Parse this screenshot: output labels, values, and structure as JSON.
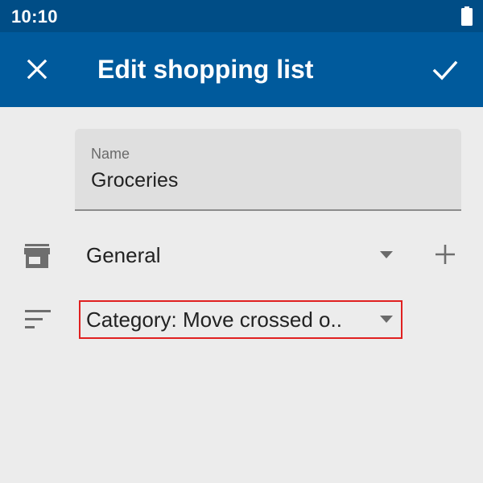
{
  "status_bar": {
    "time": "10:10",
    "battery_icon": "battery-full-icon"
  },
  "app_bar": {
    "title": "Edit shopping list",
    "close_icon": "close-icon",
    "confirm_icon": "check-icon"
  },
  "form": {
    "name_field": {
      "label": "Name",
      "value": "Groceries"
    },
    "store": {
      "icon": "store-icon",
      "selected": "General",
      "add_icon": "plus-icon"
    },
    "sort": {
      "icon": "sort-icon",
      "selected": "Category: Move crossed o.."
    }
  },
  "colors": {
    "status_bar": "#004d86",
    "app_bar": "#005a9c",
    "background": "#ececec",
    "highlight_border": "#e02020"
  }
}
